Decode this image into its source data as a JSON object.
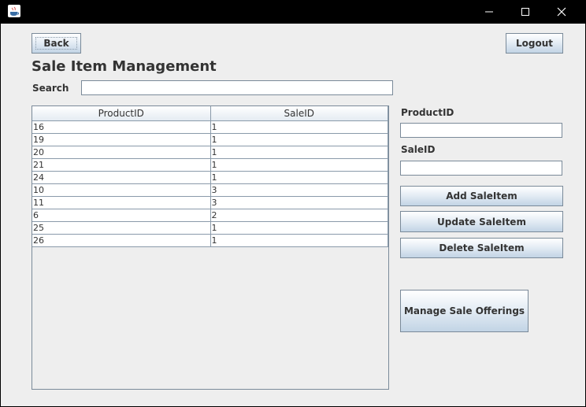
{
  "window": {
    "controls": {
      "minimize_icon": "minimize-icon",
      "maximize_icon": "maximize-icon",
      "close_icon": "close-icon"
    }
  },
  "header": {
    "back_label": "Back",
    "logout_label": "Logout",
    "title": "Sale Item Management"
  },
  "search": {
    "label": "Search",
    "value": ""
  },
  "table": {
    "columns": [
      "ProductID",
      "SaleID"
    ],
    "rows": [
      [
        "16",
        "1"
      ],
      [
        "19",
        "1"
      ],
      [
        "20",
        "1"
      ],
      [
        "21",
        "1"
      ],
      [
        "24",
        "1"
      ],
      [
        "10",
        "3"
      ],
      [
        "11",
        "3"
      ],
      [
        "6",
        "2"
      ],
      [
        "25",
        "1"
      ],
      [
        "26",
        "1"
      ]
    ]
  },
  "form": {
    "product_id_label": "ProductID",
    "product_id_value": "",
    "sale_id_label": "SaleID",
    "sale_id_value": "",
    "add_label": "Add SaleItem",
    "update_label": "Update SaleItem",
    "delete_label": "Delete SaleItem",
    "manage_label": "Manage Sale Offerings"
  },
  "colors": {
    "panel": "#eeeeee",
    "titlebar": "#000000",
    "button_bottom": "#c2d4e5",
    "border": "#7a8a99"
  }
}
